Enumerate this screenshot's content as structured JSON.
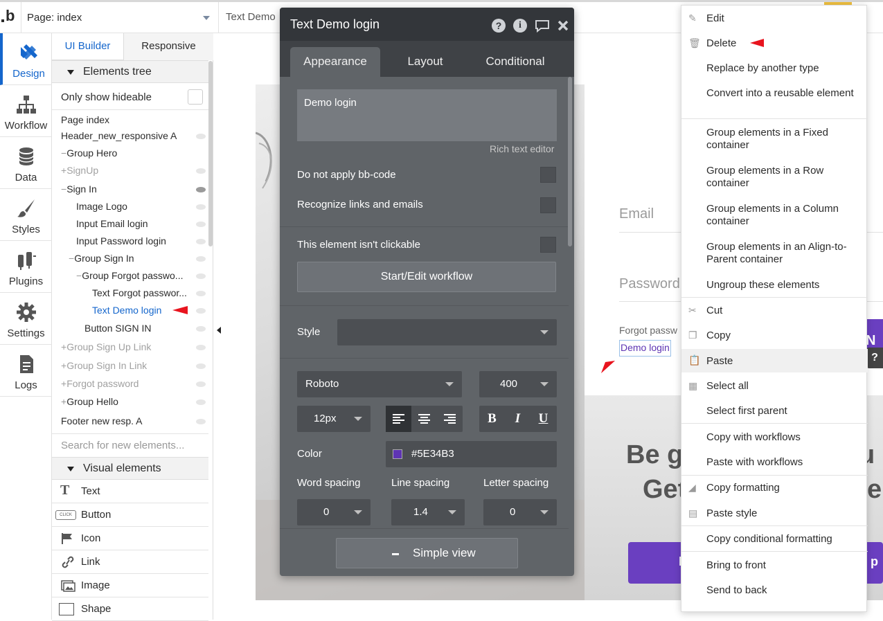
{
  "header": {
    "page_selector": "Page: index",
    "element_selector": "Text Demo"
  },
  "left_nav": [
    {
      "label": "Design",
      "icon": "design-icon"
    },
    {
      "label": "Workflow",
      "icon": "workflow-icon"
    },
    {
      "label": "Data",
      "icon": "database-icon"
    },
    {
      "label": "Styles",
      "icon": "brush-icon"
    },
    {
      "label": "Plugins",
      "icon": "plug-icon"
    },
    {
      "label": "Settings",
      "icon": "gear-icon"
    },
    {
      "label": "Logs",
      "icon": "document-icon"
    }
  ],
  "panel": {
    "tabs": [
      "UI Builder",
      "Responsive"
    ],
    "elements_tree_title": "Elements tree",
    "only_show_hideable": "Only show hideable",
    "tree": [
      "Page index",
      "Header_new_responsive A",
      "Group Hero",
      "SignUp",
      "Sign In",
      "Image Logo",
      "Input Email login",
      "Input Password login",
      "Group Sign In",
      "Group Forgot passwo...",
      "Text Forgot passwor...",
      "Text Demo login",
      "Button SIGN IN",
      "Group Sign Up Link",
      "Group Sign In Link",
      "Forgot password",
      "Group Hello",
      "Footer new resp. A"
    ],
    "search_placeholder": "Search for new elements...",
    "visual_elements_title": "Visual elements",
    "visual_elements": [
      "Text",
      "Button",
      "Icon",
      "Link",
      "Image",
      "Shape"
    ]
  },
  "canvas": {
    "email_placeholder": "Email",
    "password_placeholder": "Password",
    "forgot_text": "Forgot passw",
    "demo_login_text": "Demo login",
    "signin_fragment": "N",
    "heading_line1": "Be g",
    "heading_line1_right": "u",
    "heading_line2": "Get",
    "heading_line2_right": "e",
    "cta_left": "I",
    "cta_right": "p",
    "help_glyph": "?"
  },
  "property_editor": {
    "title": "Text Demo login",
    "tabs": [
      "Appearance",
      "Layout",
      "Conditional"
    ],
    "content": "Demo login",
    "rich_text_label": "Rich text editor",
    "checkbox_bbcode": "Do not apply bb-code",
    "checkbox_links": "Recognize links and emails",
    "checkbox_clickable": "This element isn't clickable",
    "workflow_button": "Start/Edit workflow",
    "style_label": "Style",
    "font_family": "Roboto",
    "font_weight": "400",
    "font_size": "12px",
    "color_label": "Color",
    "color_value": "#5E34B3",
    "word_spacing_label": "Word spacing",
    "line_spacing_label": "Line spacing",
    "letter_spacing_label": "Letter spacing",
    "word_spacing": "0",
    "line_spacing": "1.4",
    "letter_spacing": "0",
    "simple_view": "Simple view"
  },
  "context_menu": [
    {
      "label": "Edit",
      "icon": "pencil-icon"
    },
    {
      "label": "Delete",
      "icon": "trash-icon"
    },
    {
      "label": "Replace by another type"
    },
    {
      "label": "Convert into a reusable element"
    },
    {
      "label": "Group elements in a Fixed container"
    },
    {
      "label": "Group elements in a Row container"
    },
    {
      "label": "Group elements in a Column container"
    },
    {
      "label": "Group elements in an Align-to-Parent container"
    },
    {
      "label": "Ungroup these elements"
    },
    {
      "label": "Cut",
      "icon": "scissors-icon"
    },
    {
      "label": "Copy",
      "icon": "copy-icon"
    },
    {
      "label": "Paste",
      "icon": "paste-icon"
    },
    {
      "label": "Select all",
      "icon": "grid-icon"
    },
    {
      "label": "Select first parent"
    },
    {
      "label": "Copy with workflows"
    },
    {
      "label": "Paste with workflows"
    },
    {
      "label": "Copy formatting",
      "icon": "eraser-icon"
    },
    {
      "label": "Paste style",
      "icon": "page-icon"
    },
    {
      "label": "Copy conditional formatting"
    },
    {
      "label": "Bring to front"
    },
    {
      "label": "Send to back"
    }
  ],
  "colors": {
    "accent": "#1466cc",
    "brand_purple": "#6a3fc0",
    "text_color": "#5E34B3",
    "annotation_arrow": "#e8141e"
  }
}
